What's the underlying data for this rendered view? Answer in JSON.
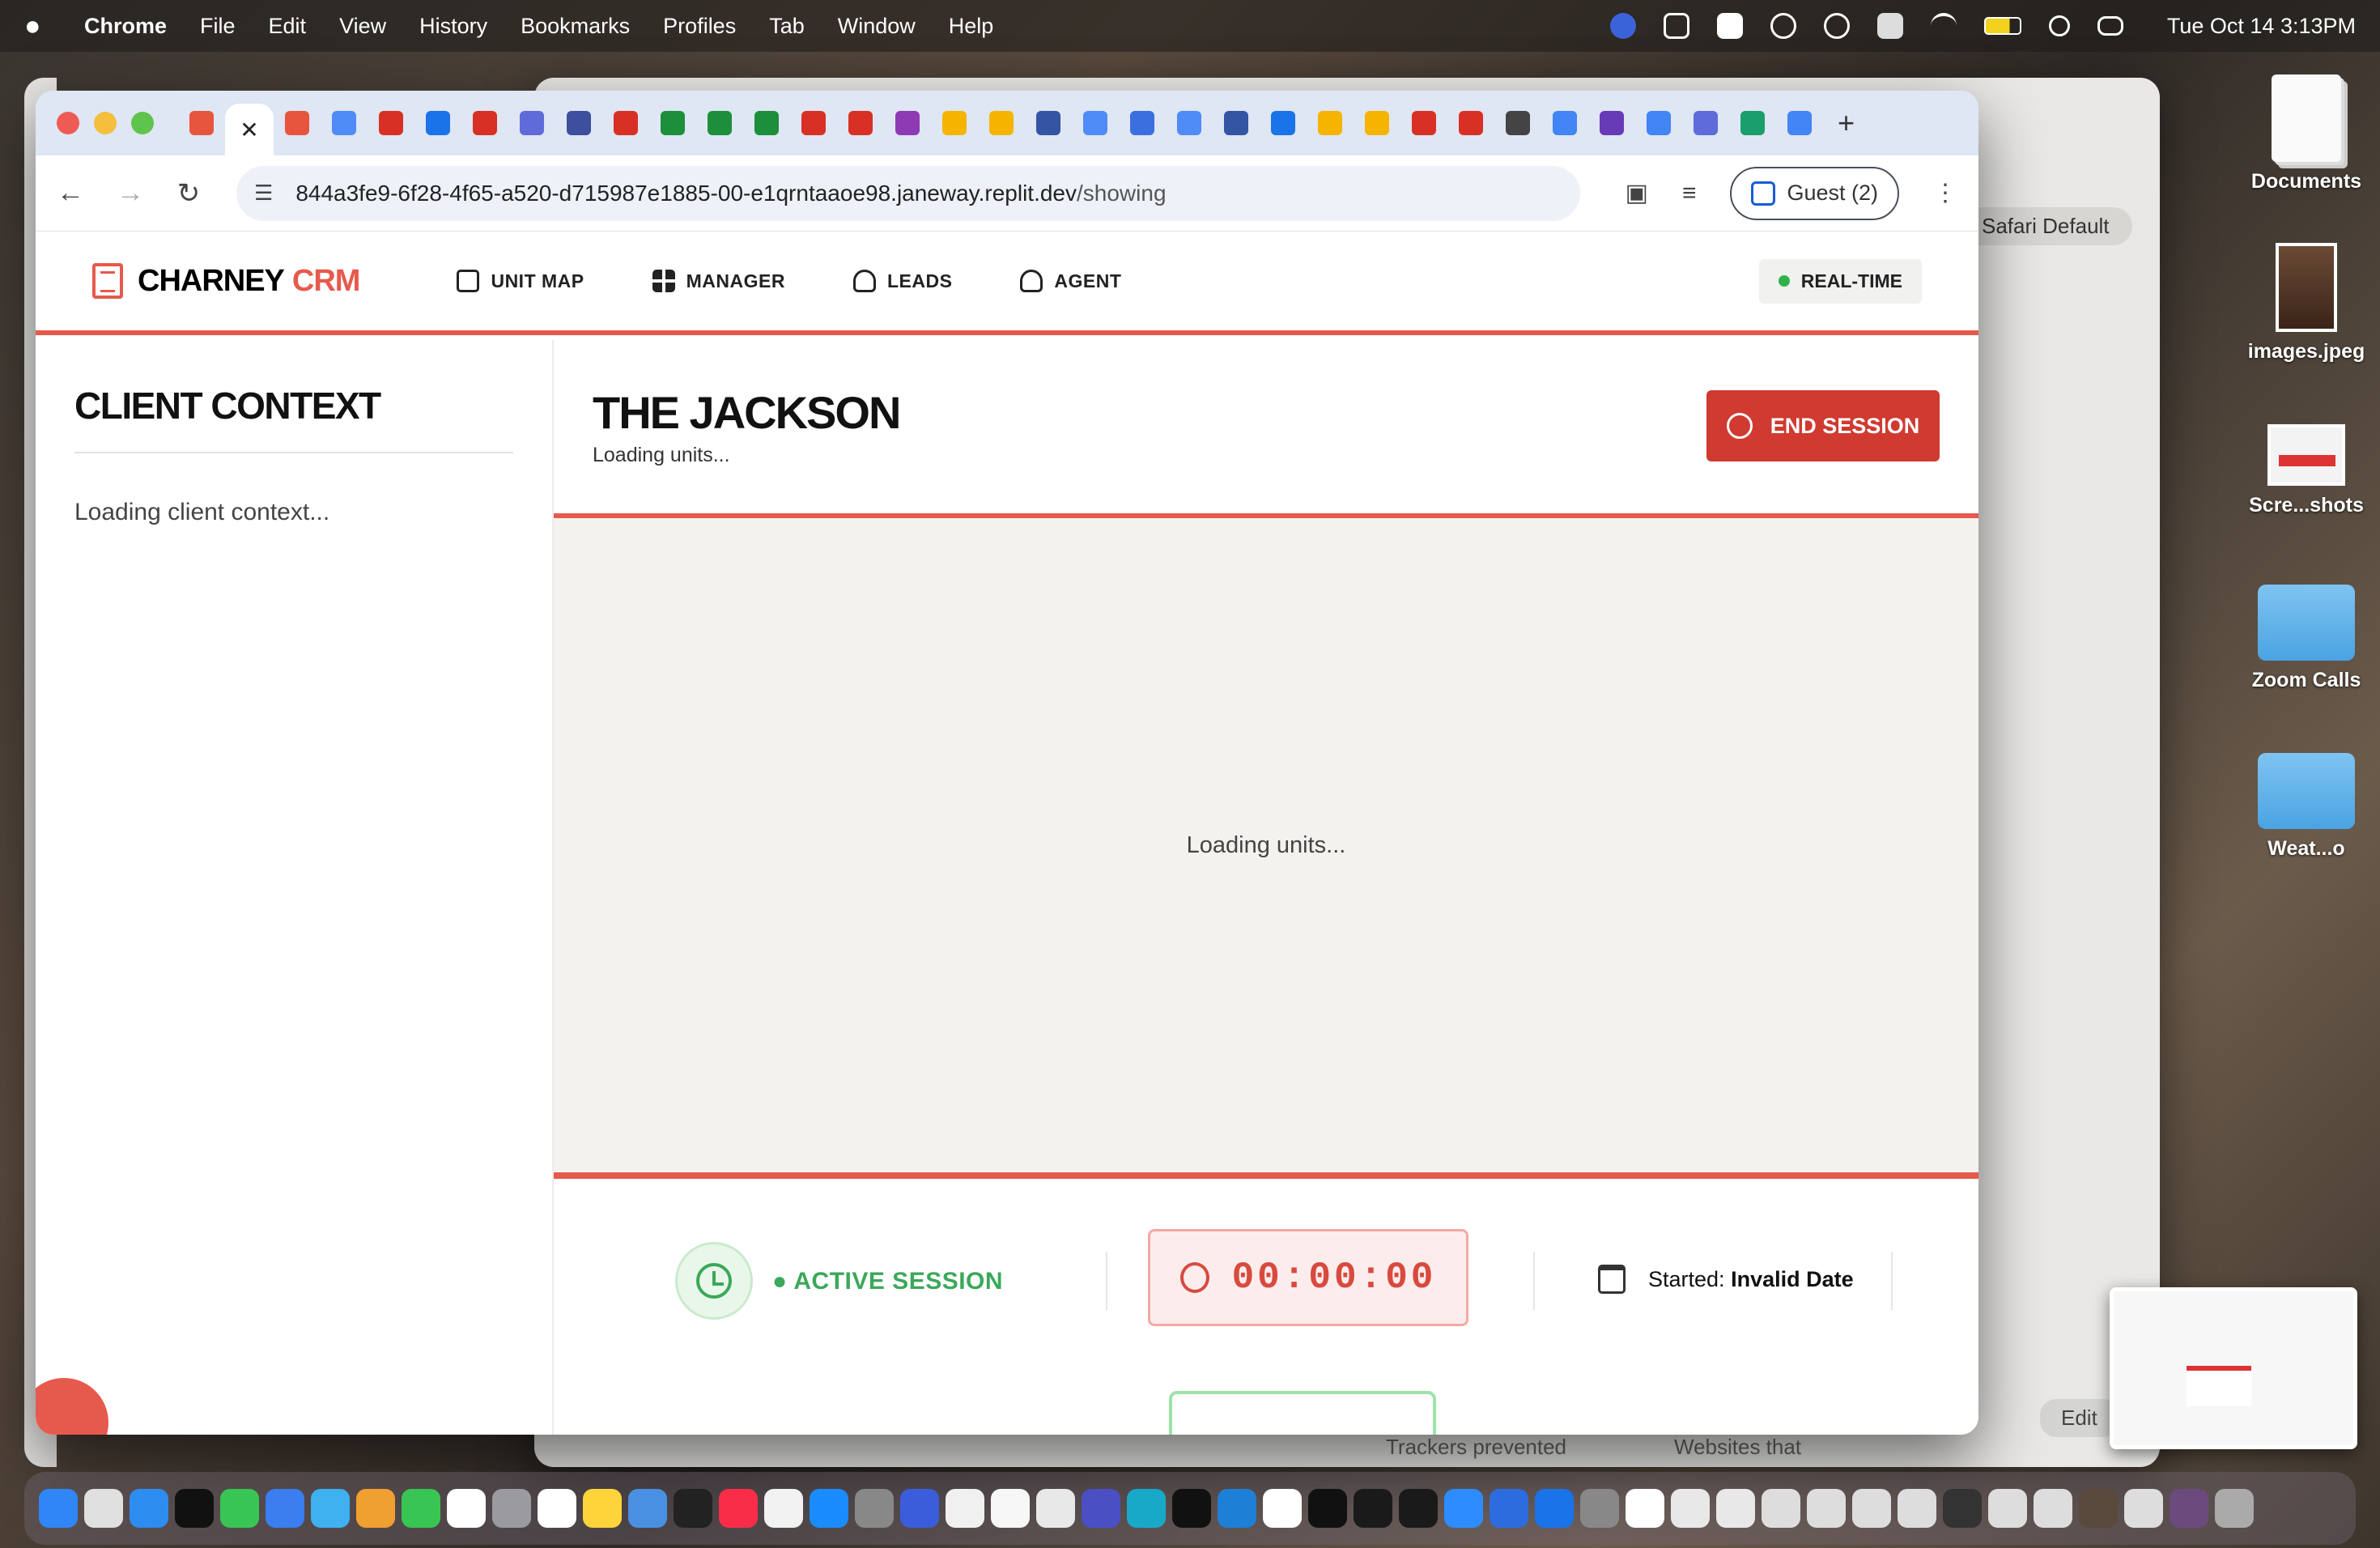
{
  "menubar": {
    "app": "Chrome",
    "items": [
      "File",
      "Edit",
      "View",
      "History",
      "Bookmarks",
      "Profiles",
      "Tab",
      "Window",
      "Help"
    ],
    "clock": "Tue Oct 14  3:13PM"
  },
  "bg_window": {
    "safari_default": "Safari Default",
    "edit": "Edit",
    "trackers": "Trackers prevented",
    "websites": "Websites that"
  },
  "desktop": {
    "items": [
      {
        "label": "Documents",
        "icon": "document-stack-icon"
      },
      {
        "label": "images.jpeg",
        "icon": "photo-file-icon"
      },
      {
        "label": "Scre...shots",
        "icon": "screenshot-file-icon"
      },
      {
        "label": "Zoom Calls",
        "icon": "folder-icon"
      },
      {
        "label": "Weat...o",
        "icon": "folder-icon"
      }
    ]
  },
  "browser": {
    "url_host": "844a3fe9-6f28-4f65-a520-d715987e1885-00-e1qrntaaoe98.janeway.replit.dev",
    "url_path": "/showing",
    "guest_label": "Guest (2)",
    "close_tab": "✕",
    "new_tab": "+",
    "tab_favicons": [
      "#e8553e",
      "#4f8cf7",
      "#d93025",
      "#1a73e8",
      "#d93025",
      "#5f6bd9",
      "#3d4f9d",
      "#d93025",
      "#1d8f3a",
      "#1d8f3a",
      "#1d8f3a",
      "#d93025",
      "#d93025",
      "#8e3ab5",
      "#f4b400",
      "#f4b400",
      "#3455a4",
      "#4f8cf7",
      "#3b6fe0",
      "#4f8cf7",
      "#3455a4",
      "#1a73e8",
      "#f4b400",
      "#f4b400",
      "#d93025",
      "#d93025",
      "#444444",
      "#4285f4",
      "#673ab7",
      "#4285f4",
      "#5f6bd9",
      "#1a9e6b",
      "#4285f4"
    ]
  },
  "app": {
    "brand_main": "CHARNEY",
    "brand_accent": "CRM",
    "nav": [
      {
        "label": "UNIT MAP",
        "icon": "building-icon"
      },
      {
        "label": "MANAGER",
        "icon": "grid-icon"
      },
      {
        "label": "LEADS",
        "icon": "users-icon"
      },
      {
        "label": "AGENT",
        "icon": "user-gear-icon"
      }
    ],
    "realtime": "REAL-TIME",
    "sidebar_title": "CLIENT CONTEXT",
    "sidebar_loading": "Loading client context...",
    "unit_title": "THE JACKSON",
    "unit_sub": "Loading units...",
    "end_session": "END SESSION",
    "units_loading": "Loading units...",
    "active_session": "● ACTIVE SESSION",
    "timer": "00:00:00",
    "started_label": "Started:",
    "started_value": "Invalid Date"
  },
  "colors": {
    "accent": "#e65a4d",
    "end_button": "#d03a30",
    "active_green": "#3ba85a"
  },
  "dock": {
    "apps": [
      "#2f86f6",
      "#e0e0e0",
      "#2d8cf0",
      "#111111",
      "#39c553",
      "#3a7ef0",
      "#3fb0f0",
      "#f0a030",
      "#39c553",
      "#ffffff",
      "#9a9aa0",
      "#ffffff",
      "#ffd43b",
      "#4a90e2",
      "#222222",
      "#fa2d48",
      "#f2f2f2",
      "#1a8cff",
      "#888888",
      "#3b5ddb",
      "#f0f0f0",
      "#f7f7f7",
      "#e8e8e8",
      "#4a4fc4",
      "#19a9c8",
      "#111111",
      "#1e7fd6",
      "#ffffff",
      "#111111",
      "#1a1a1a",
      "#1a1a1a",
      "#2d8cff",
      "#2d6cdf",
      "#1a73e8",
      "#888888",
      "#ffffff",
      "#e8e8e8",
      "#e8e8e8",
      "#dddddd",
      "#dddddd",
      "#dddddd",
      "#dddddd",
      "#333333",
      "#dddddd",
      "#dddddd",
      "#5a4a3e",
      "#dddddd",
      "#6b4a7e",
      "#aaaaaa"
    ]
  }
}
